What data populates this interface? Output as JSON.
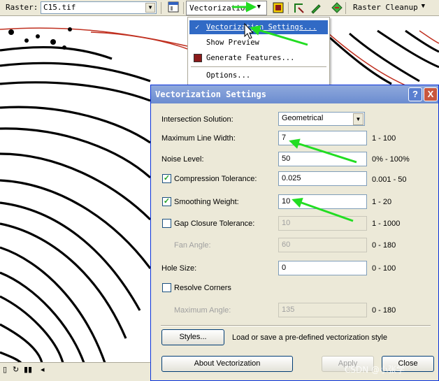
{
  "toolbar": {
    "raster_label": "Raster:",
    "raster_value": "C15.tif",
    "vectorization_menu": "Vectorization",
    "raster_cleanup_menu": "Raster Cleanup"
  },
  "menu": {
    "items": [
      {
        "label": "Vectorization Settings...",
        "checked": true,
        "highlighted": true
      },
      {
        "label": "Show Preview"
      },
      {
        "label": "Generate Features..."
      },
      {
        "label": "Options..."
      }
    ]
  },
  "dialog": {
    "title": "Vectorization Settings",
    "help_glyph": "?",
    "close_glyph": "X",
    "intersection_solution": {
      "label": "Intersection Solution:",
      "value": "Geometrical"
    },
    "max_line_width": {
      "label": "Maximum Line Width:",
      "value": "7",
      "range": "1 - 100"
    },
    "noise_level": {
      "label": "Noise Level:",
      "value": "50",
      "range": "0% - 100%"
    },
    "compression_tolerance": {
      "label": "Compression Tolerance:",
      "value": "0.025",
      "range": "0.001 - 50",
      "checked": true
    },
    "smoothing_weight": {
      "label": "Smoothing Weight:",
      "value": "10",
      "range": "1 - 20",
      "checked": true
    },
    "gap_closure_tolerance": {
      "label": "Gap Closure Tolerance:",
      "value": "10",
      "range": "1 - 1000",
      "checked": false
    },
    "fan_angle": {
      "label": "Fan Angle:",
      "value": "60",
      "range": "0 - 180"
    },
    "hole_size": {
      "label": "Hole Size:",
      "value": "0",
      "range": "0 - 100"
    },
    "resolve_corners": {
      "label": "Resolve Corners",
      "checked": false
    },
    "maximum_angle": {
      "label": "Maximum Angle:",
      "value": "135",
      "range": "0 - 180"
    },
    "styles_button": "Styles...",
    "styles_description": "Load or save a pre-defined vectorization style",
    "about_button": "About Vectorization",
    "apply_button": "Apply",
    "close_button": "Close",
    "checkmark_glyph": "✓"
  },
  "watermark": "CSDN @小张学"
}
